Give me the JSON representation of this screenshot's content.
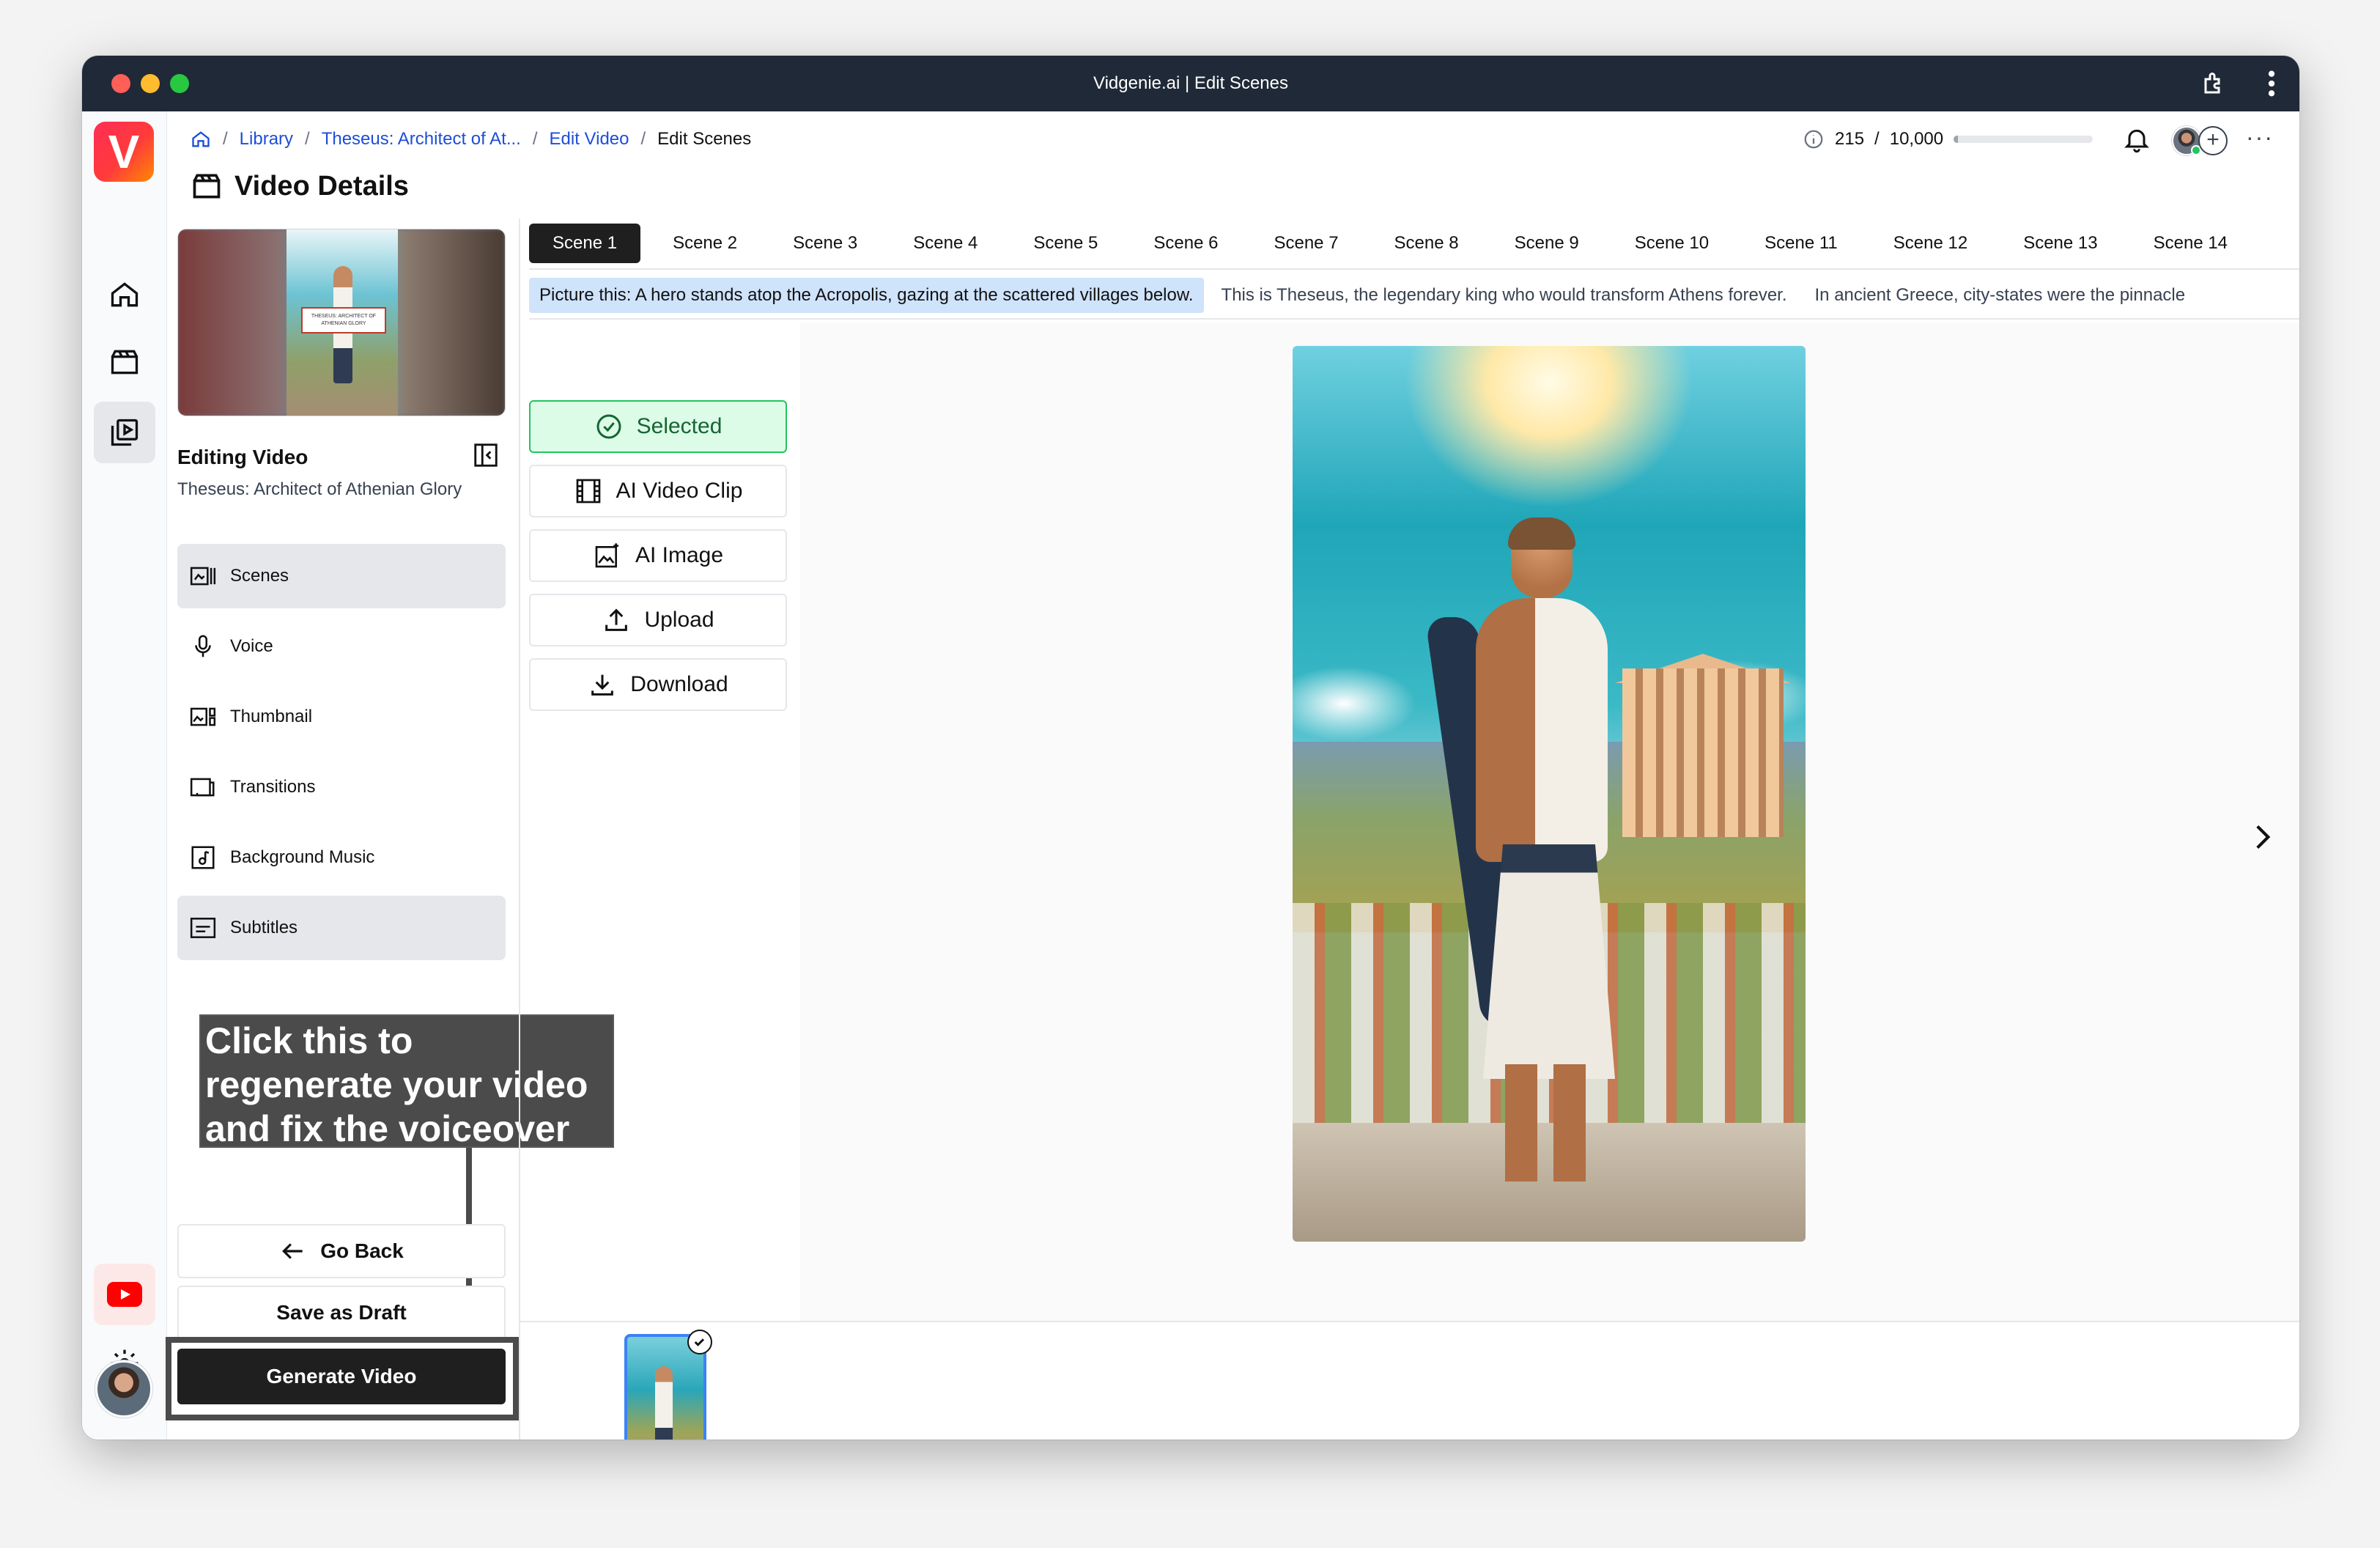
{
  "window": {
    "title": "Vidgenie.ai | Edit Scenes"
  },
  "brand": {
    "logo_letter": "V",
    "accent": "#ff3b3b"
  },
  "rail": {
    "items": [
      {
        "name": "home-icon"
      },
      {
        "name": "clapperboard-icon"
      },
      {
        "name": "video-library-icon",
        "active": true
      }
    ],
    "bottom": [
      {
        "name": "youtube-icon"
      },
      {
        "name": "gear-icon"
      }
    ]
  },
  "breadcrumb": {
    "items": [
      "Library",
      "Theseus: Architect of At...",
      "Edit Video"
    ],
    "current": "Edit Scenes",
    "separator": "/"
  },
  "header": {
    "credits_used": "215",
    "credits_sep": "/",
    "credits_total": "10,000",
    "credits_fraction": 0.0215
  },
  "page": {
    "title": "Video Details"
  },
  "sidebar": {
    "heading": "Editing Video",
    "video_title": "Theseus: Architect of Athenian Glory",
    "thumb_text": "THESEUS: ARCHITECT OF ATHENIAN GLORY",
    "nav": [
      {
        "label": "Scenes",
        "icon": "scenes-icon",
        "active": true
      },
      {
        "label": "Voice",
        "icon": "microphone-icon",
        "active": false
      },
      {
        "label": "Thumbnail",
        "icon": "thumbnail-icon",
        "active": false
      },
      {
        "label": "Transitions",
        "icon": "transitions-icon",
        "active": false
      },
      {
        "label": "Background Music",
        "icon": "music-icon",
        "active": false
      },
      {
        "label": "Subtitles",
        "icon": "subtitles-icon",
        "active": true
      }
    ],
    "go_back": "Go Back",
    "save_draft": "Save as Draft",
    "generate": "Generate Video"
  },
  "callout": {
    "text": "Click this to regenerate your video and fix the voiceover issue."
  },
  "scenes": {
    "tabs": [
      "Scene 1",
      "Scene 2",
      "Scene 3",
      "Scene 4",
      "Scene 5",
      "Scene 6",
      "Scene 7",
      "Scene 8",
      "Scene 9",
      "Scene 10",
      "Scene 11",
      "Scene 12",
      "Scene 13",
      "Scene 14"
    ],
    "active_index": 0,
    "scripts": [
      "Picture this: A hero stands atop the Acropolis, gazing at the scattered villages below.",
      "This is Theseus, the legendary king who would transform Athens forever.",
      "In ancient Greece, city-states were the pinnacle"
    ]
  },
  "actions": {
    "selected": "Selected",
    "ai_video_clip": "AI Video Clip",
    "ai_image": "AI Image",
    "upload": "Upload",
    "download": "Download"
  }
}
